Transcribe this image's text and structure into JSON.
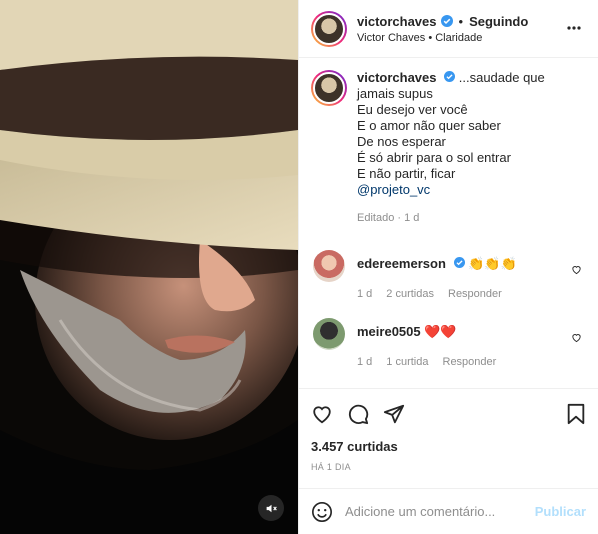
{
  "post": {
    "username": "victorchaves",
    "follow_status": "Seguindo",
    "subtitle": "Victor Chaves • Claridade",
    "caption_first": "...saudade que",
    "caption_lines": [
      "jamais supus",
      "Eu desejo ver você",
      "E o amor não quer saber",
      "De nos esperar",
      "É só abrir para o sol entrar",
      "E não partir, ficar"
    ],
    "mention": "@projeto_vc",
    "caption_meta": "Editado · 1 d"
  },
  "comments": [
    {
      "username": "edereemerson",
      "text": "👏👏👏",
      "age": "1 d",
      "likes": "2 curtidas",
      "reply": "Responder"
    },
    {
      "username": "meire0505",
      "text": "❤️❤️",
      "age": "1 d",
      "likes": "1 curtida",
      "reply": "Responder"
    }
  ],
  "stats": {
    "likes": "3.457 curtidas",
    "time": "HÁ 1 DIA"
  },
  "composer": {
    "placeholder": "Adicione um comentário...",
    "publish": "Publicar"
  },
  "icons": {
    "more": "more-icon",
    "like": "heart-icon",
    "comment": "comment-icon",
    "share": "share-icon",
    "save": "bookmark-icon",
    "emoji": "emoji-icon",
    "mute": "muted-speaker-icon",
    "verified": "verified-badge-icon"
  },
  "colors": {
    "verified": "#3897f0",
    "link": "#00376b",
    "publish": "#b2dffc"
  }
}
